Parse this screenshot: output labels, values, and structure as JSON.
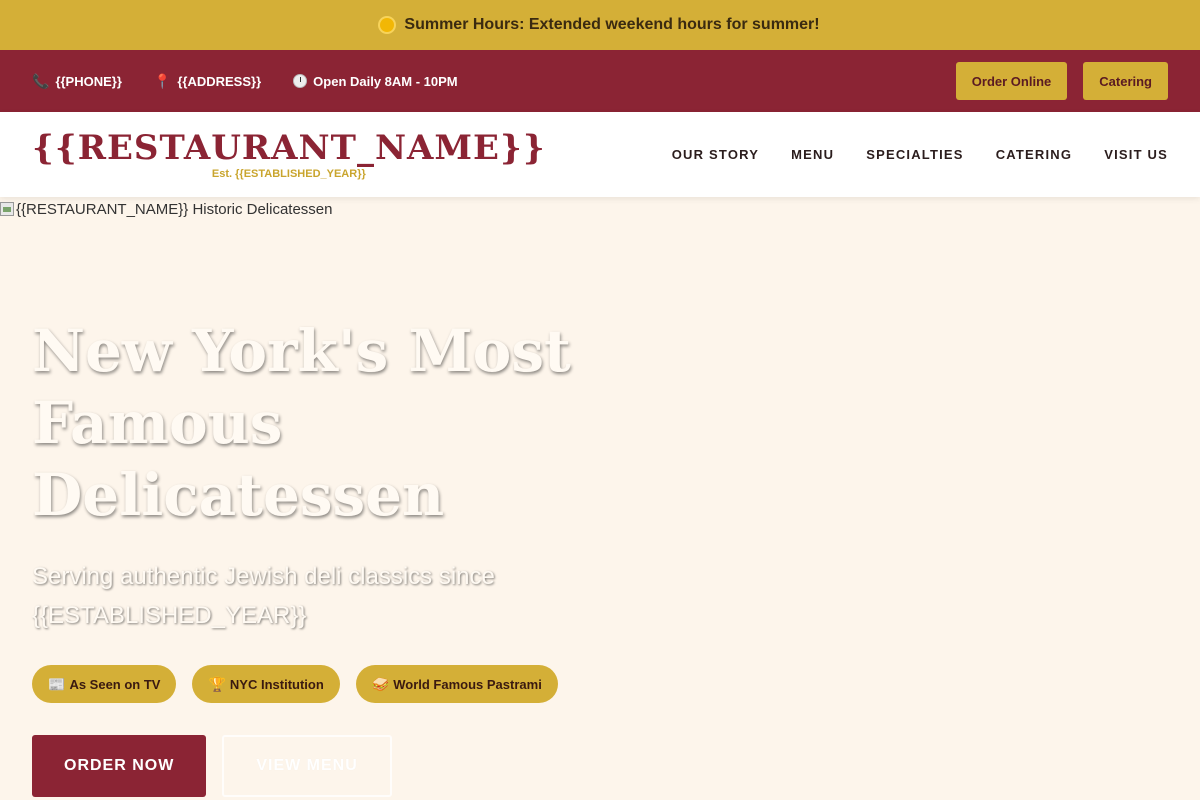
{
  "announcement": {
    "text": "Summer Hours: Extended weekend hours for summer!",
    "icon": "sun-icon"
  },
  "topbar": {
    "phone": "{{PHONE}}",
    "address": "{{ADDRESS}}",
    "hours": "Open Daily 8AM - 10PM",
    "order_online": "Order Online",
    "catering": "Catering"
  },
  "brand": {
    "name": "{{RESTAURANT_NAME}}",
    "established": "Est. {{ESTABLISHED_YEAR}}"
  },
  "nav": {
    "items": [
      "OUR STORY",
      "MENU",
      "SPECIALTIES",
      "CATERING",
      "VISIT US"
    ]
  },
  "hero": {
    "image_alt": "{{RESTAURANT_NAME}} Historic Delicatessen",
    "title": "New York's Most Famous Delicatessen",
    "subtitle": "Serving authentic Jewish deli classics since {{ESTABLISHED_YEAR}}",
    "badges": [
      {
        "icon": "newspaper-icon",
        "label": "As Seen on TV"
      },
      {
        "icon": "trophy-icon",
        "label": "NYC Institution"
      },
      {
        "icon": "sandwich-icon",
        "label": "World Famous Pastrami"
      }
    ],
    "order_now": "ORDER NOW",
    "view_menu": "VIEW MENU"
  },
  "colors": {
    "gold": "#d4af37",
    "burgundy": "#8b2434",
    "cream": "#fdf5eb"
  }
}
